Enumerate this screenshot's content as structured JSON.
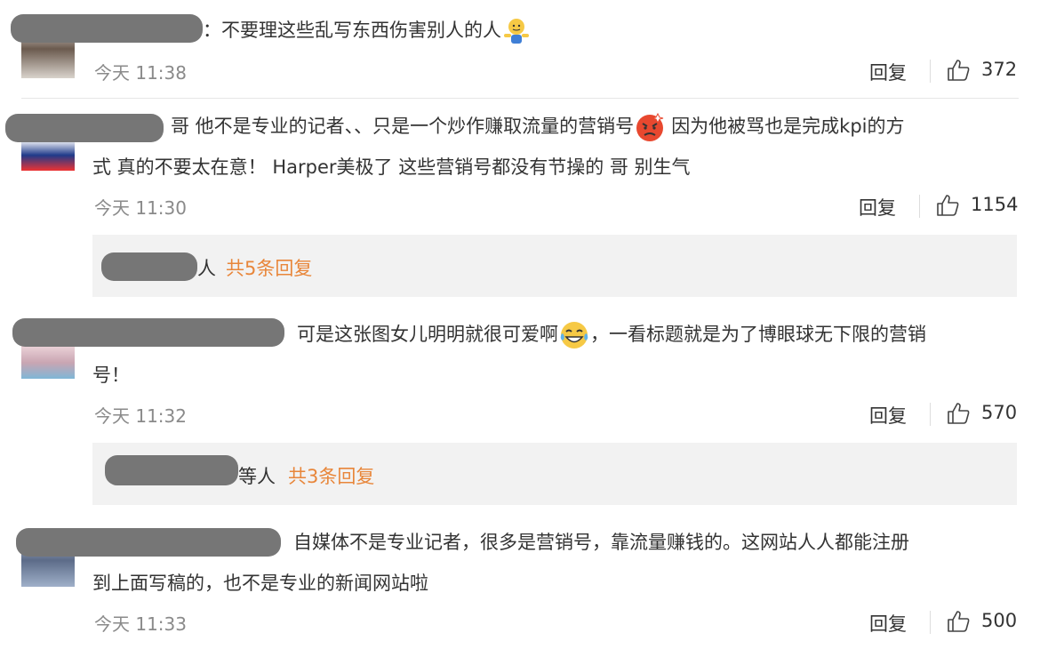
{
  "comments": [
    {
      "text": "：不要理这些乱写东西伤害别人的人",
      "time": "今天 11:38",
      "reply_label": "回复",
      "likes": "372"
    },
    {
      "text_line1": "哥 他不是专业的记者、、只是一个炒作赚取流量的营销号",
      "text_line1b": "因为他被骂也是完成kpi的方",
      "text_line2": "式 真的不要太在意！ Harper美极了 这些营销号都没有节操的 哥 别生气",
      "time": "今天 11:30",
      "reply_label": "回复",
      "likes": "1154",
      "sub_suffix": "人",
      "sub_count": "共5条回复"
    },
    {
      "text_line1a": "可是这张图女儿明明就很可爱啊",
      "text_line1b": "，一看标题就是为了博眼球无下限的营销",
      "text_line2": "号！",
      "time": "今天 11:32",
      "reply_label": "回复",
      "likes": "570",
      "sub_suffix": "等人",
      "sub_count": "共3条回复"
    },
    {
      "text_line1": "自媒体不是专业记者，很多是营销号，靠流量赚钱的。这网站人人都能注册",
      "text_line2": "到上面写稿的，也不是专业的新闻网站啦",
      "time": "今天 11:33",
      "reply_label": "回复",
      "likes": "500"
    }
  ],
  "icons": {
    "like": "thumbs-up-icon"
  }
}
